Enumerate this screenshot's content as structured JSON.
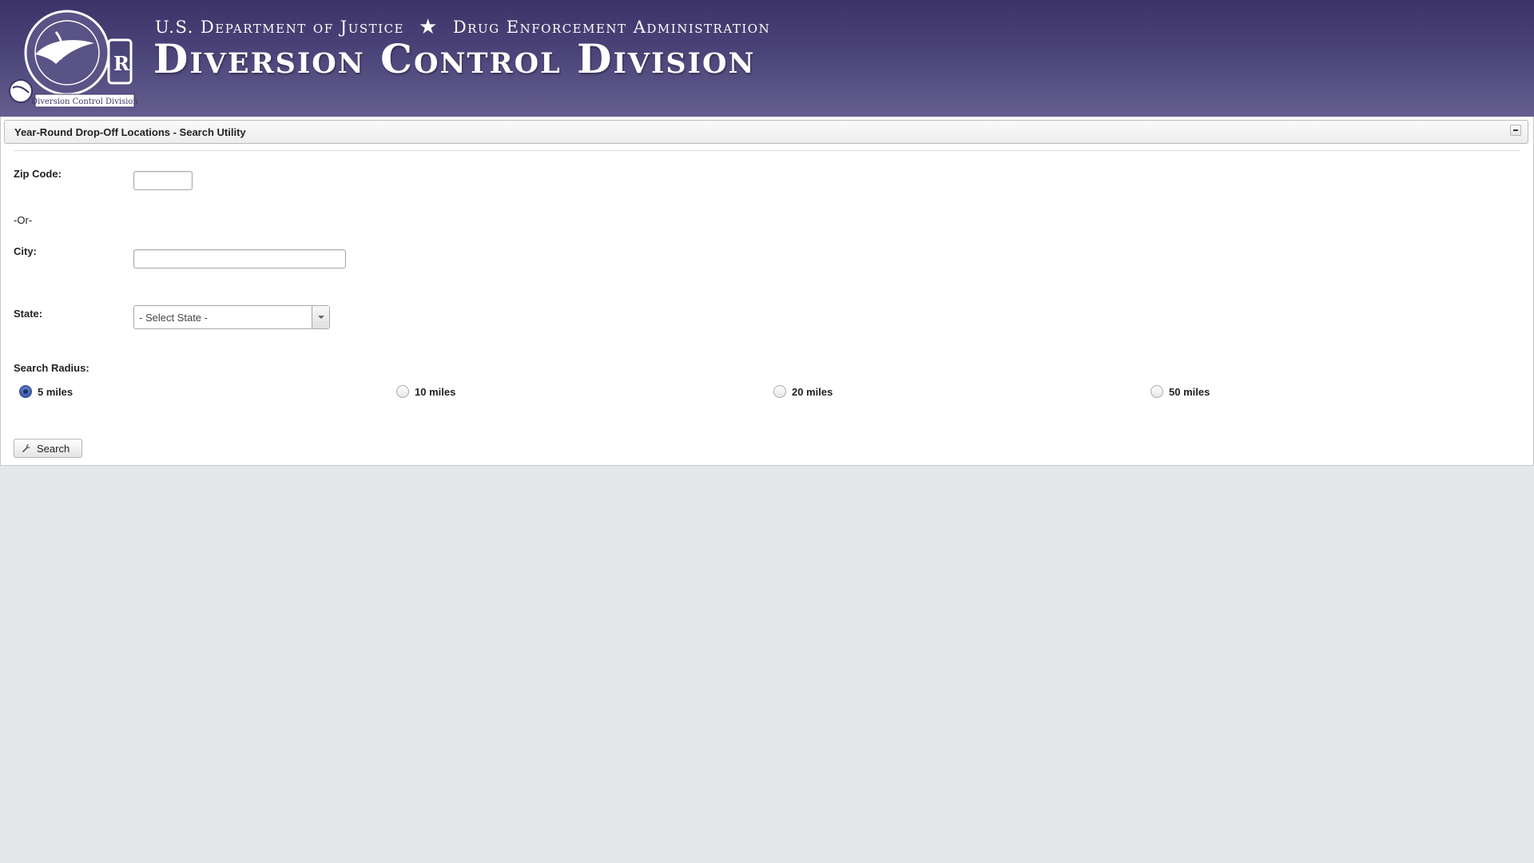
{
  "banner": {
    "department": "U.S. Department of Justice",
    "administration": "Drug Enforcement Administration",
    "division": "Diversion Control Division",
    "seal_text": "Diversion Control Division"
  },
  "panel": {
    "title": "Year-Round Drop-Off Locations - Search Utility"
  },
  "form": {
    "zip_label": "Zip Code:",
    "zip_value": "",
    "or_text": "-Or-",
    "city_label": "City:",
    "city_value": "",
    "state_label": "State:",
    "state_selected": "- Select State -",
    "radius_label": "Search Radius:",
    "radius_options": [
      {
        "label": "5 miles",
        "checked": true
      },
      {
        "label": "10 miles",
        "checked": false
      },
      {
        "label": "20 miles",
        "checked": false
      },
      {
        "label": "50 miles",
        "checked": false
      }
    ],
    "search_label": "Search"
  },
  "colors": {
    "banner_top": "#3c3468",
    "banner_bottom": "#655f8f",
    "page_background": "#e6e7e9",
    "radio_checked": "#3b5ba8"
  }
}
